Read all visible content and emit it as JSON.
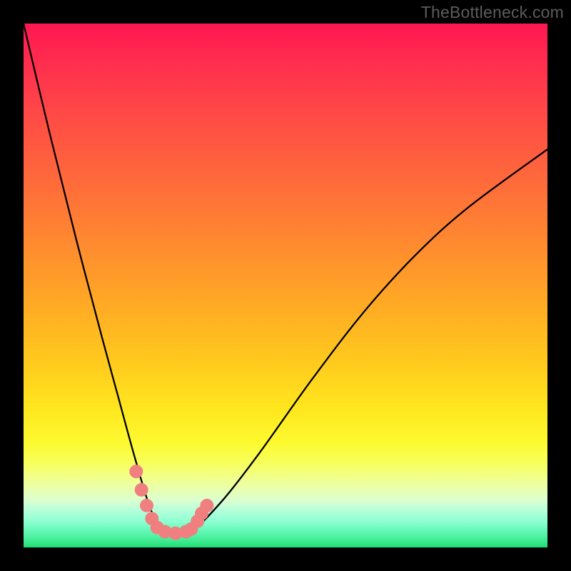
{
  "watermark": "TheBottleneck.com",
  "chart_data": {
    "type": "line",
    "title": "",
    "xlabel": "",
    "ylabel": "",
    "xlim": [
      0,
      100
    ],
    "ylim": [
      0,
      100
    ],
    "grid": false,
    "series": [
      {
        "name": "bottleneck-curve",
        "x": [
          0,
          5,
          10,
          15,
          18,
          21,
          24,
          26.5,
          29,
          32,
          38,
          45,
          55,
          65,
          75,
          85,
          100
        ],
        "values": [
          100,
          79,
          59,
          40,
          29,
          18,
          8,
          3,
          2.5,
          3,
          9,
          18,
          32,
          45,
          56,
          65,
          76
        ],
        "color": "#000000"
      }
    ],
    "markers": {
      "name": "highlight-dots",
      "color": "#f08080",
      "points": [
        {
          "x": 21.5,
          "y": 14.5
        },
        {
          "x": 22.5,
          "y": 11
        },
        {
          "x": 23.5,
          "y": 8
        },
        {
          "x": 24.5,
          "y": 5.5
        },
        {
          "x": 25.5,
          "y": 3.8
        },
        {
          "x": 27.0,
          "y": 3.0
        },
        {
          "x": 29.0,
          "y": 2.7
        },
        {
          "x": 31.0,
          "y": 3.0
        },
        {
          "x": 32.0,
          "y": 3.5
        },
        {
          "x": 33.2,
          "y": 5.0
        },
        {
          "x": 34.0,
          "y": 6.5
        },
        {
          "x": 35.0,
          "y": 8.0
        }
      ]
    },
    "background_gradient": {
      "top_color": "#ff1751",
      "bottom_color": "#1fde6f",
      "stops": [
        "red",
        "orange",
        "yellow",
        "green"
      ]
    }
  }
}
